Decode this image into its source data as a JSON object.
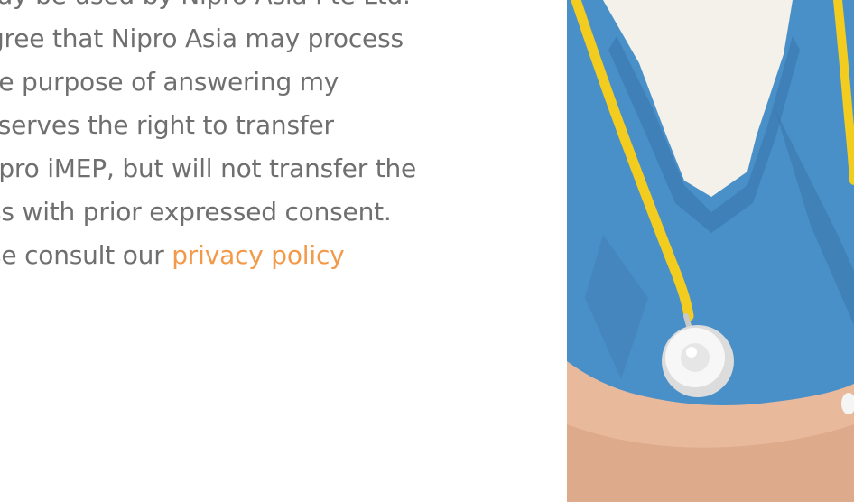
{
  "consent": {
    "lines": [
      "may be used by Nipro Asia Pte Ltd.",
      "agree that Nipro Asia may process",
      "the purpose of answering my",
      "reserves the right to transfer",
      "Nipro iMEP, but will not transfer the",
      "ess with prior expressed consent.",
      "ase consult our "
    ],
    "link_text": "privacy policy"
  },
  "photo": {
    "subject": "healthcare-worker-with-stethoscope",
    "colors": {
      "scrubs": "#4a90c8",
      "stethoscope_tube": "#f2cc1f",
      "skin": "#e9b99c",
      "undershirt": "#f3f1ea"
    }
  },
  "colors": {
    "body_text": "#6f6f6f",
    "link": "#f39a4a",
    "background": "#ffffff"
  }
}
